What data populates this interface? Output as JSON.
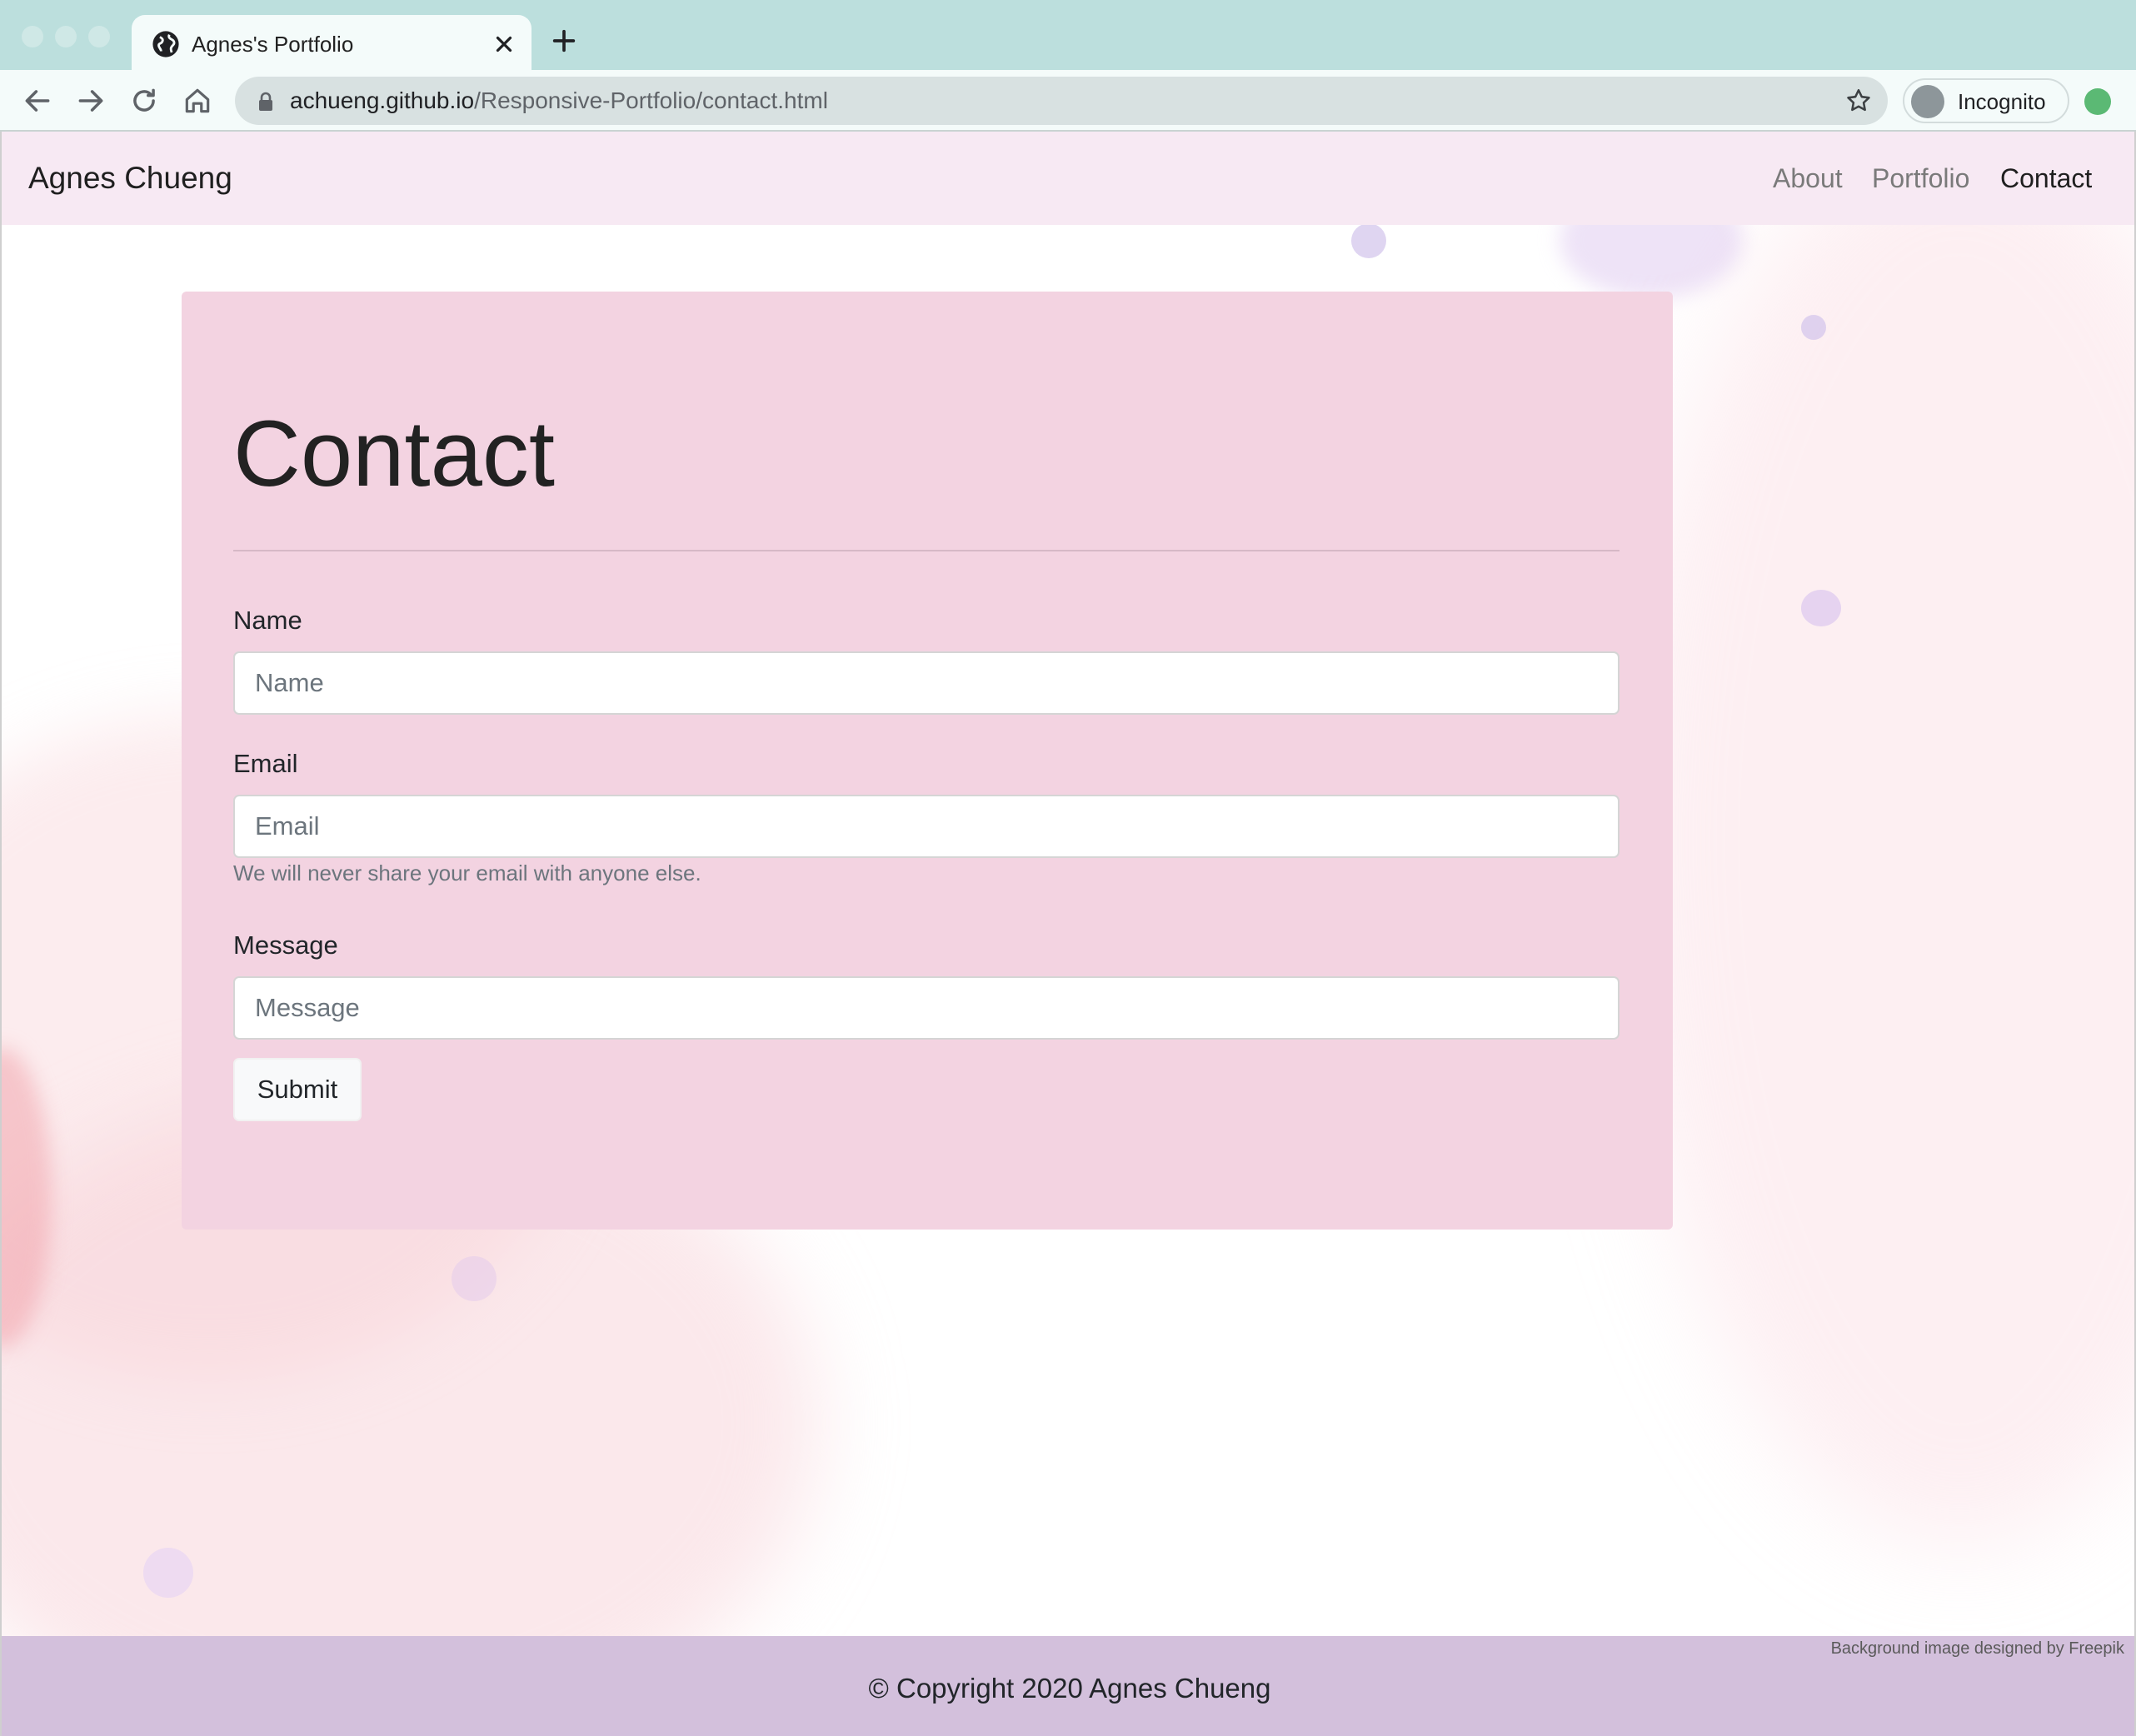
{
  "browser": {
    "tab_title": "Agnes's Portfolio",
    "url_host": "achueng.github.io",
    "url_path": "/Responsive-Portfolio/contact.html",
    "profile_label": "Incognito"
  },
  "navbar": {
    "brand": "Agnes Chueng",
    "links": [
      {
        "label": "About",
        "active": false
      },
      {
        "label": "Portfolio",
        "active": false
      },
      {
        "label": "Contact",
        "active": true
      }
    ]
  },
  "contact": {
    "title": "Contact",
    "name_label": "Name",
    "name_placeholder": "Name",
    "email_label": "Email",
    "email_placeholder": "Email",
    "email_help": "We will never share your email with anyone else.",
    "message_label": "Message",
    "message_placeholder": "Message",
    "submit_label": "Submit"
  },
  "footer": {
    "credit": "Background image designed by Freepik",
    "copyright": "© Copyright 2020 Agnes Chueng"
  },
  "colors": {
    "navbar_bg": "#f7e9f3",
    "card_bg": "#f3d3e1",
    "footer_bg": "#d3c0dc",
    "browser_frame": "#bcdfdd"
  }
}
